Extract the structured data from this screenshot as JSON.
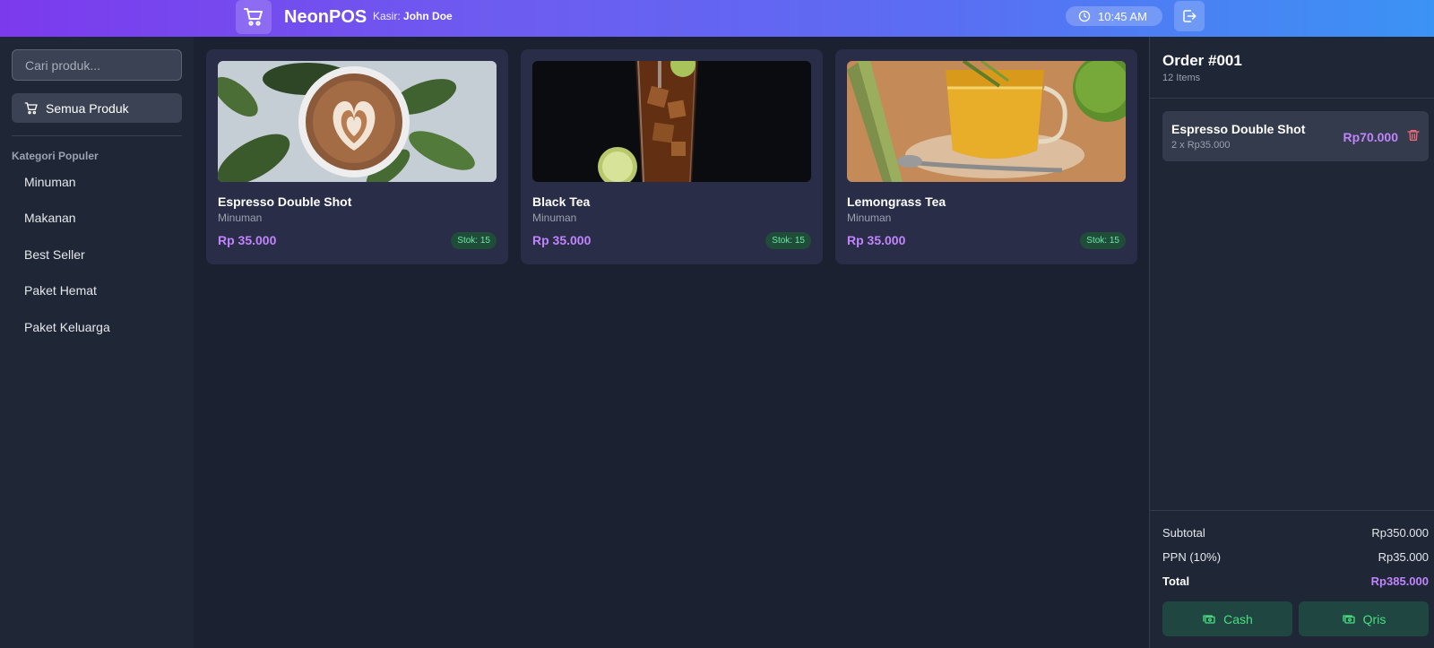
{
  "header": {
    "app_name": "NeonPOS",
    "cashier_label": "Kasir:",
    "cashier_name": "John Doe",
    "time": "10:45 AM",
    "logo_icon": "cart-icon",
    "clock_icon": "clock-icon",
    "logout_icon": "logout-icon"
  },
  "sidebar": {
    "search_placeholder": "Cari produk...",
    "all_products_label": "Semua Produk",
    "category_title": "Kategori Populer",
    "categories": [
      "Minuman",
      "Makanan",
      "Best Seller",
      "Paket Hemat",
      "Paket Keluarga"
    ]
  },
  "products": [
    {
      "name": "Espresso Double Shot",
      "category": "Minuman",
      "price": "Rp 35.000",
      "stock": "Stok: 15",
      "image": "latte-art-coffee-photo"
    },
    {
      "name": "Black Tea",
      "category": "Minuman",
      "price": "Rp 35.000",
      "stock": "Stok: 15",
      "image": "iced-tea-glass-photo"
    },
    {
      "name": "Lemongrass Tea",
      "category": "Minuman",
      "price": "Rp 35.000",
      "stock": "Stok: 15",
      "image": "lemongrass-tea-cup-photo"
    }
  ],
  "order": {
    "title": "Order #001",
    "item_count": "12 Items",
    "items": [
      {
        "name": "Espresso Double Shot",
        "detail": "2 x Rp35.000",
        "total": "Rp70.000"
      }
    ],
    "subtotal_label": "Subtotal",
    "subtotal_value": "Rp350.000",
    "tax_label": "PPN (10%)",
    "tax_value": "Rp35.000",
    "total_label": "Total",
    "total_value": "Rp385.000",
    "pay_cash_label": "Cash",
    "pay_qris_label": "Qris"
  },
  "colors": {
    "accent_purple": "#c084fc",
    "success_green": "#4ade80",
    "header_gradient_start": "#7c3aed",
    "header_gradient_end": "#3b93f5"
  }
}
